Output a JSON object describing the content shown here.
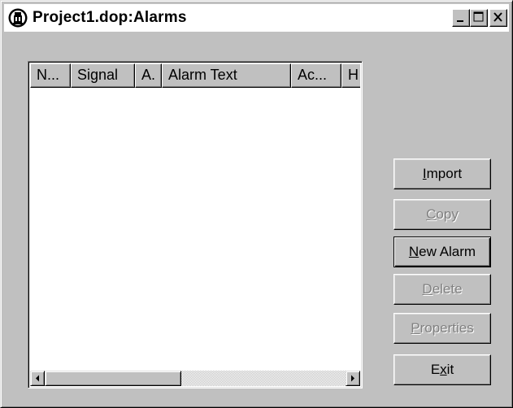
{
  "window": {
    "title": "Project1.dop:Alarms",
    "icon": "app-icon",
    "caption_buttons": [
      "minimize-icon",
      "maximize-icon",
      "close-icon"
    ]
  },
  "list": {
    "columns": [
      "N...",
      "Signal",
      "A.",
      "Alarm Text",
      "Ac...",
      "H"
    ],
    "rows": []
  },
  "buttons": {
    "import": {
      "label": "Import",
      "mnemonic": "I",
      "rest": "mport",
      "enabled": true
    },
    "copy": {
      "label": "Copy",
      "mnemonic": "C",
      "rest": "opy",
      "enabled": false
    },
    "new_alarm": {
      "label": "New Alarm",
      "mnemonic": "N",
      "rest": "ew Alarm",
      "enabled": true,
      "default": true
    },
    "delete": {
      "label": "Delete",
      "mnemonic": "D",
      "rest": "elete",
      "enabled": false
    },
    "properties": {
      "label": "Properties",
      "mnemonic": "P",
      "rest": "roperties",
      "enabled": false
    },
    "exit": {
      "label": "Exit",
      "pre": "E",
      "mnemonic": "x",
      "rest": "it",
      "enabled": true
    }
  }
}
